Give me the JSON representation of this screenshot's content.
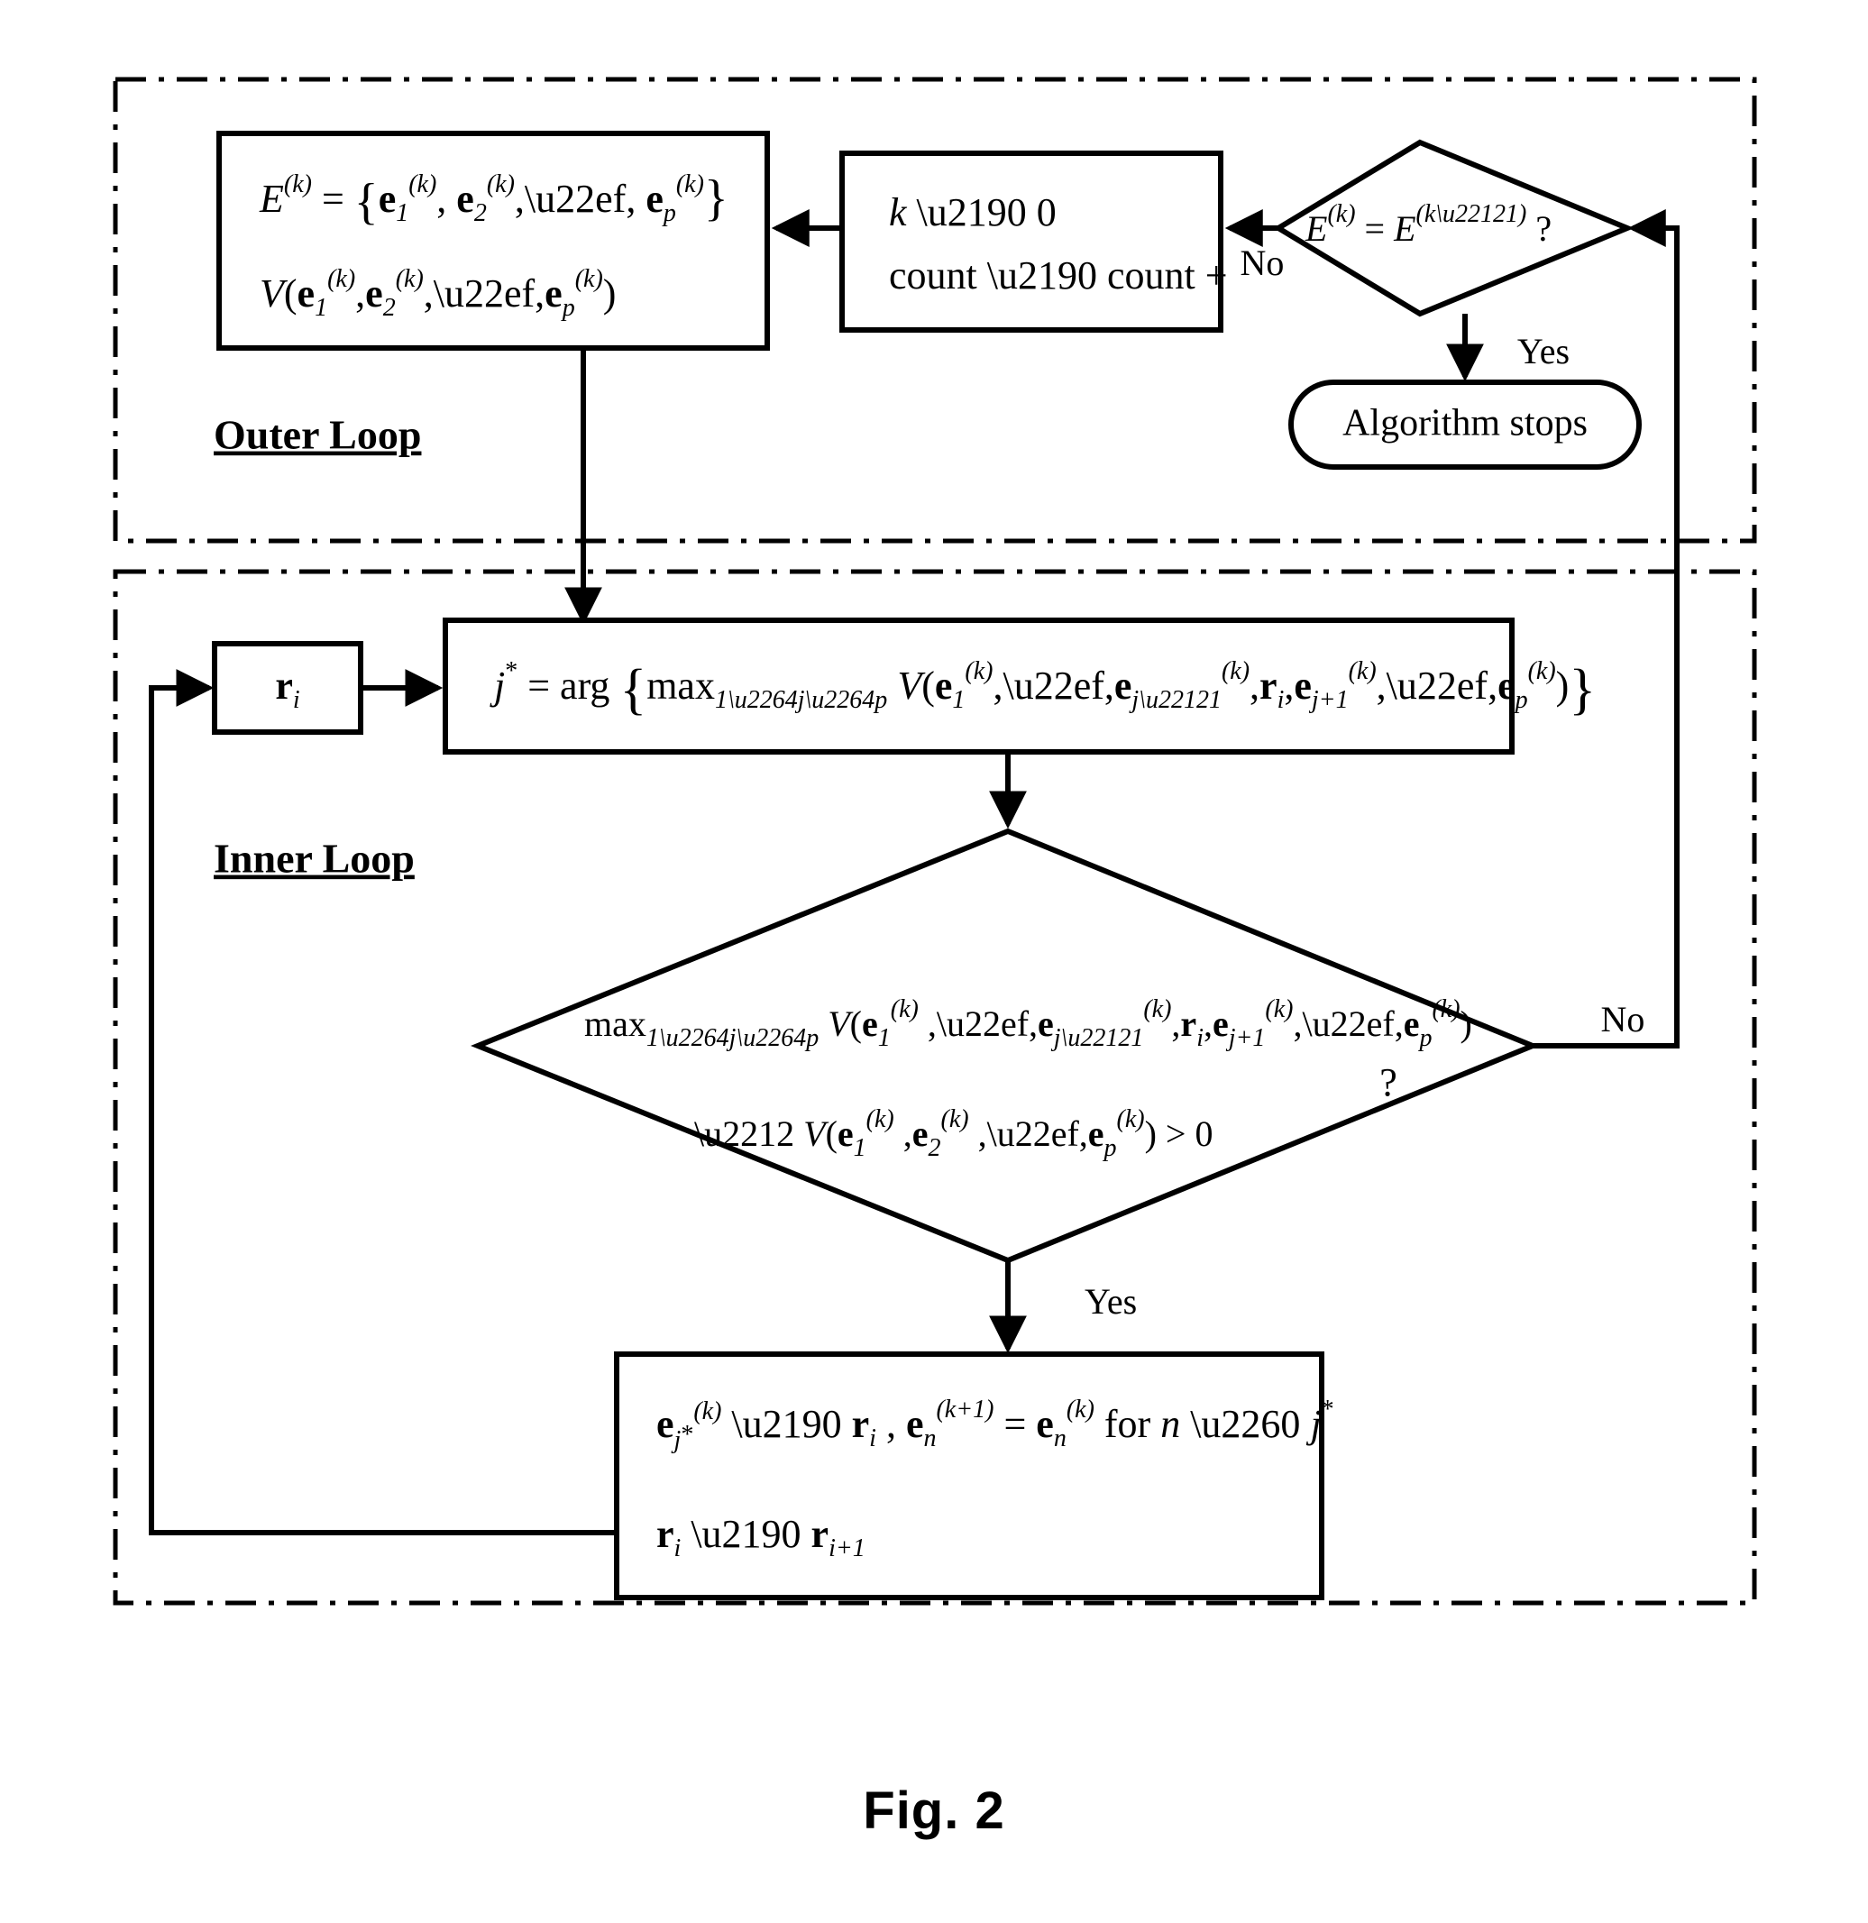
{
  "figure": {
    "caption": "Fig. 2",
    "groups": [
      {
        "id": "outer",
        "label": "Outer Loop"
      },
      {
        "id": "inner",
        "label": "Inner Loop"
      }
    ]
  },
  "outer_loop": {
    "label": "Outer Loop",
    "nodes": {
      "codebook_box": {
        "type": "process",
        "line1_parts": {
          "lhs": "E",
          "lhs_sup": "(k)",
          "eq": "=",
          "open_brace": "{",
          "e1": "e",
          "e1_sub": "1",
          "e1_sup": "(k)",
          "comma1": ",",
          "e2": "e",
          "e2_sub": "2",
          "e2_sup": "(k)",
          "comma2": ",",
          "dots": "⋯",
          "comma3": ",",
          "ep": "e",
          "ep_sub": "p",
          "ep_sup": "(k)",
          "close_brace": "}"
        },
        "line2_parts": {
          "V": "V",
          "open": "(",
          "e1": "e",
          "e1_sub": "1",
          "e1_sup": "(k)",
          "comma1": ",",
          "e2": "e",
          "e2_sub": "2",
          "e2_sup": "(k)",
          "comma2": ",",
          "dots": "⋯",
          "comma3": ",",
          "ep": "e",
          "ep_sub": "p",
          "ep_sup": "(k)",
          "close": ")"
        },
        "text_line1": "E^(k) = {e_1^(k), e_2^(k), ⋯, e_p^(k)}",
        "text_line2": "V(e_1^(k), e_2^(k), ⋯, e_p^(k))"
      },
      "init_box": {
        "type": "process",
        "line1": "k ← 0",
        "line2": "count ← count +"
      },
      "compare_diamond": {
        "type": "decision",
        "lhs": "E",
        "lhs_sup": "(k)",
        "eq": "=",
        "rhs": "E",
        "rhs_sup": "(k−1)",
        "question": "?",
        "text": "E^(k) = E^(k−1) ?"
      },
      "stop_oval": {
        "type": "terminator",
        "label": "Algorithm stops"
      }
    },
    "edge_labels": {
      "no": "No",
      "yes": "Yes"
    }
  },
  "inner_loop": {
    "label": "Inner Loop",
    "nodes": {
      "ri_box": {
        "type": "process",
        "symbol": "r",
        "subscript": "i",
        "text": "r_i"
      },
      "argmax_box": {
        "type": "process",
        "text": "j* = arg{ max_{1≤j≤p} V(e_1^(k), ⋯, e_{j−1}^(k), r_i, e_{j+1}^(k), ⋯, e_p^(k)) }",
        "parts": {
          "j": "j",
          "star": "*",
          "eq": "=",
          "arg": "arg",
          "open_brace": "{",
          "max": "max",
          "max_sub": "1≤j≤p",
          "V": "V",
          "open_paren": "(",
          "e1": "e",
          "e1_sub": "1",
          "e1_sup": "(k)",
          "dots1": "⋯",
          "ejm1": "e",
          "ejm1_sub": "j−1",
          "ejm1_sup": "(k)",
          "ri": "r",
          "ri_sub": "i",
          "ejp1": "e",
          "ejp1_sub": "j+1",
          "ejp1_sup": "(k)",
          "dots2": "⋯",
          "ep": "e",
          "ep_sub": "p",
          "ep_sup": "(k)",
          "close_paren": ")",
          "close_brace": "}"
        }
      },
      "gain_diamond": {
        "type": "decision",
        "line1": "max_{1≤j≤p} V(e_1^(k), ⋯, e_{j−1}^(k), r_i, e_{j+1}^(k), ⋯, e_p^(k))",
        "line2": "− V(e_1^(k), e_2^(k), ⋯, e_p^(k)) > 0",
        "question": "?"
      },
      "update_box": {
        "type": "process",
        "line1": "e_{j*}^(k) ← r_i , e_n^(k+1) = e_n^(k) for n ≠ j*",
        "line2": "r_i ← r_{i+1}"
      }
    },
    "edge_labels": {
      "no": "No",
      "yes": "Yes"
    }
  },
  "colors": {
    "ink": "#000000",
    "paper": "#ffffff"
  }
}
